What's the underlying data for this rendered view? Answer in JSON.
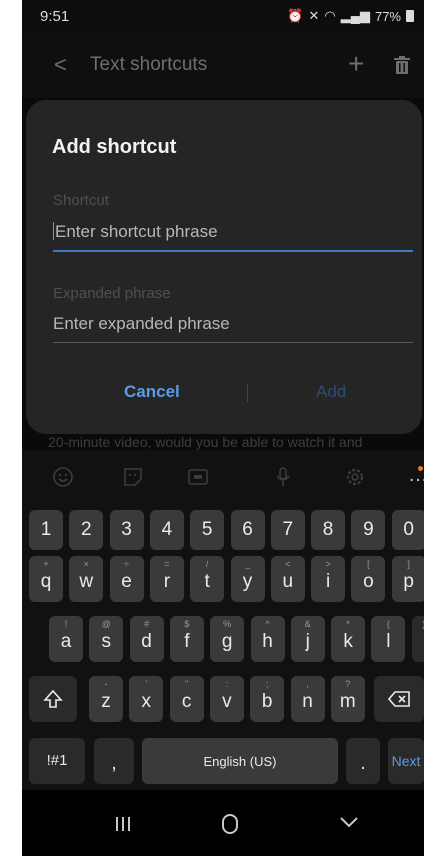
{
  "status_bar": {
    "time": "9:51",
    "battery": "77%"
  },
  "app_bar": {
    "title": "Text shortcuts"
  },
  "dialog": {
    "title": "Add shortcut",
    "shortcut_label": "Shortcut",
    "shortcut_placeholder": "Enter shortcut phrase",
    "expanded_label": "Expanded phrase",
    "expanded_placeholder": "Enter expanded phrase",
    "cancel_label": "Cancel",
    "add_label": "Add"
  },
  "background_text": "20-minute video, would you be able to watch it and",
  "keyboard": {
    "numbers": [
      "1",
      "2",
      "3",
      "4",
      "5",
      "6",
      "7",
      "8",
      "9",
      "0"
    ],
    "row1": [
      {
        "k": "q",
        "s": "+"
      },
      {
        "k": "w",
        "s": "×"
      },
      {
        "k": "e",
        "s": "÷"
      },
      {
        "k": "r",
        "s": "="
      },
      {
        "k": "t",
        "s": "/"
      },
      {
        "k": "y",
        "s": "_"
      },
      {
        "k": "u",
        "s": "<"
      },
      {
        "k": "i",
        "s": ">"
      },
      {
        "k": "o",
        "s": "["
      },
      {
        "k": "p",
        "s": "]"
      }
    ],
    "row2": [
      {
        "k": "a",
        "s": "!"
      },
      {
        "k": "s",
        "s": "@"
      },
      {
        "k": "d",
        "s": "#"
      },
      {
        "k": "f",
        "s": "$"
      },
      {
        "k": "g",
        "s": "%"
      },
      {
        "k": "h",
        "s": "^"
      },
      {
        "k": "j",
        "s": "&"
      },
      {
        "k": "k",
        "s": "*"
      },
      {
        "k": "l",
        "s": "("
      }
    ],
    "row2_extra_sub": ")",
    "row3": [
      {
        "k": "z",
        "s": "-"
      },
      {
        "k": "x",
        "s": "'"
      },
      {
        "k": "c",
        "s": "\""
      },
      {
        "k": "v",
        "s": ":"
      },
      {
        "k": "b",
        "s": ";"
      },
      {
        "k": "n",
        "s": ","
      },
      {
        "k": "m",
        "s": "?"
      }
    ],
    "symbols_label": "!#1",
    "comma_label": ",",
    "space_label": "English (US)",
    "period_label": ".",
    "next_label": "Next"
  },
  "colors": {
    "accent": "#5d9ae3",
    "dialog_bg": "#252525",
    "key_bg": "#3a3a3a"
  }
}
